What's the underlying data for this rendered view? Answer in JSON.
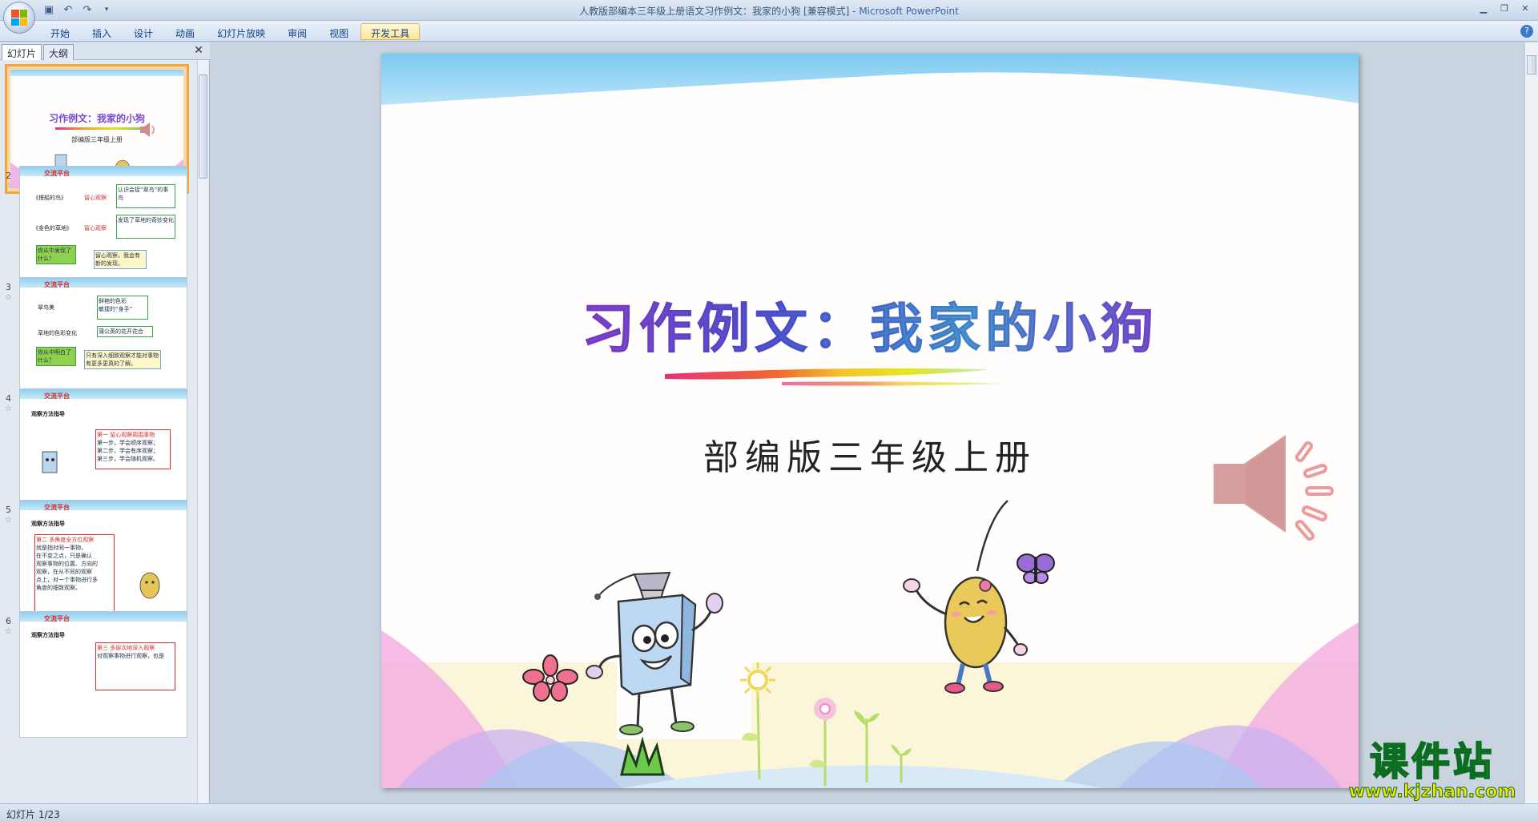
{
  "window": {
    "title": "人教版部编本三年级上册语文习作例文：我家的小狗 [兼容模式] - ",
    "app_name": "Microsoft PowerPoint"
  },
  "ribbon": {
    "tabs": [
      "开始",
      "插入",
      "设计",
      "动画",
      "幻灯片放映",
      "审阅",
      "视图",
      "开发工具"
    ],
    "active_tab": "开发工具"
  },
  "panel": {
    "tab_slides": "幻灯片",
    "tab_outline": "大纲"
  },
  "thumbnails": [
    {
      "num": "1",
      "title": "习作例文：我家的小狗",
      "subtitle": "部编版三年级上册"
    },
    {
      "num": "2",
      "heading": "交流平台",
      "lines": [
        "《搭船的鸟》",
        "留心观察",
        "认识会捉“翠鸟”的事鸟",
        "《金色的草地》",
        "留心观察",
        "发现了草地的奇妙变化",
        "你从中发现了什么？",
        "留心观察，我会有新的发现。"
      ]
    },
    {
      "num": "3",
      "heading": "交流平台",
      "lines": [
        "翠鸟美",
        "鲜艳的色彩",
        "敏捷的“身手”",
        "草地的色彩变化",
        "蒲公英的花开花合",
        "你从中明白了什么？",
        "只有深入细致观察才能对事物有更多更真的了解。"
      ]
    },
    {
      "num": "4",
      "heading": "交流平台",
      "lines": [
        "观察方法指导",
        "第一 留心观察周围事物",
        "第一步，学会顺序观察；",
        "第二步，学会有序观察；",
        "第三步，学会随机观察。"
      ]
    },
    {
      "num": "5",
      "heading": "交流平台",
      "lines": [
        "观察方法指导",
        "第二 多角度全方位观察",
        "就是指对同一事物，",
        "在不变之点，只是确认",
        "观察事物的位置、方向的",
        "观察，在从不同的观察",
        "点上，对一个事物进行多",
        "角度的细致观察。"
      ]
    },
    {
      "num": "6",
      "heading": "交流平台",
      "lines": [
        "观察方法指导",
        "第三 多层次地深入观察",
        "对观察事物进行观察，也是"
      ]
    }
  ],
  "slide": {
    "title": "习作例文：我家的小狗",
    "subtitle": "部编版三年级上册"
  },
  "status": {
    "text": "幻灯片 1/23"
  },
  "watermark": {
    "main": "课件站",
    "url": "www.kjzhan.com"
  }
}
